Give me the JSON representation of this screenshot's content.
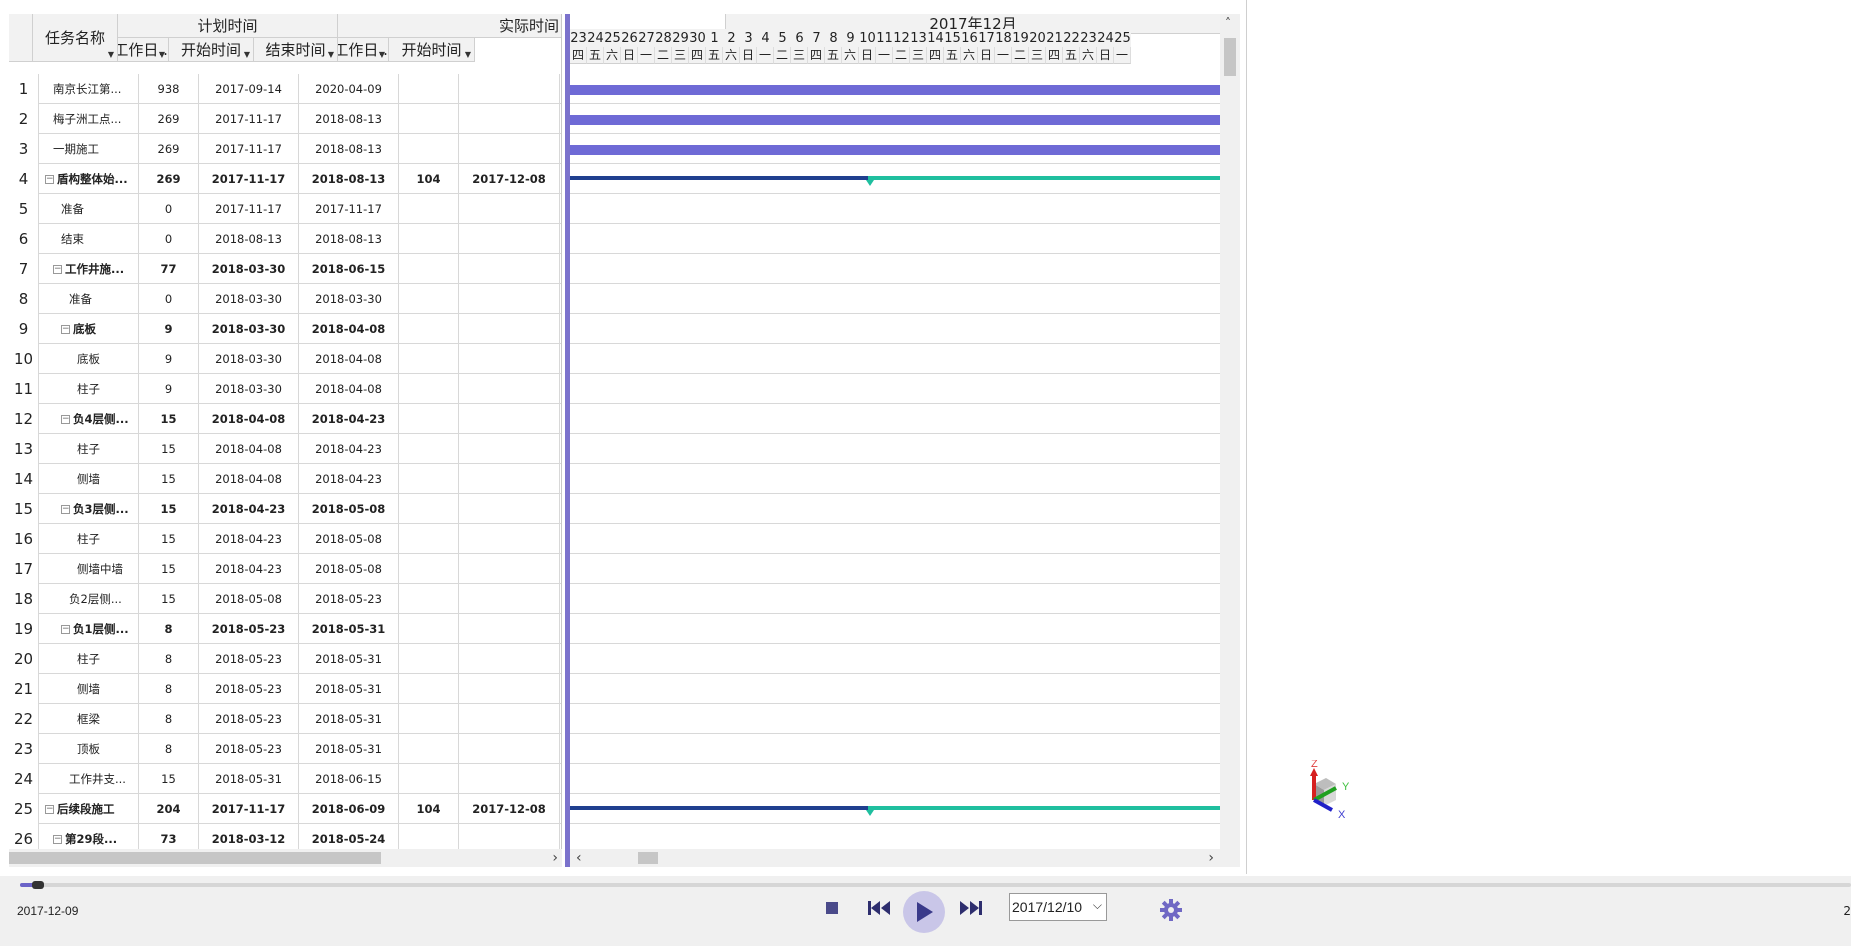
{
  "grid": {
    "headers": {
      "task_name": "任务名称",
      "plan_group": "计划时间",
      "actual_group": "实际时间",
      "plan_workdays": "工作日...",
      "plan_start": "开始时间",
      "plan_end": "结束时间",
      "actual_workdays": "工作日...",
      "actual_start": "开始时间"
    },
    "rows": [
      {
        "no": "1",
        "name": "南京长江第...",
        "workdays": "938",
        "start": "2017-09-14",
        "end": "2020-04-09",
        "a_workdays": "",
        "a_start": "",
        "summary": false,
        "indent": 0
      },
      {
        "no": "2",
        "name": "梅子洲工点...",
        "workdays": "269",
        "start": "2017-11-17",
        "end": "2018-08-13",
        "a_workdays": "",
        "a_start": "",
        "summary": false,
        "indent": 0
      },
      {
        "no": "3",
        "name": "一期施工",
        "workdays": "269",
        "start": "2017-11-17",
        "end": "2018-08-13",
        "a_workdays": "",
        "a_start": "",
        "summary": false,
        "indent": 0
      },
      {
        "no": "4",
        "name": "盾构整体始...",
        "workdays": "269",
        "start": "2017-11-17",
        "end": "2018-08-13",
        "a_workdays": "104",
        "a_start": "2017-12-08",
        "summary": true,
        "indent": 0
      },
      {
        "no": "5",
        "name": "准备",
        "workdays": "0",
        "start": "2017-11-17",
        "end": "2017-11-17",
        "a_workdays": "",
        "a_start": "",
        "summary": false,
        "indent": 1
      },
      {
        "no": "6",
        "name": "结束",
        "workdays": "0",
        "start": "2018-08-13",
        "end": "2018-08-13",
        "a_workdays": "",
        "a_start": "",
        "summary": false,
        "indent": 1
      },
      {
        "no": "7",
        "name": "工作井施...",
        "workdays": "77",
        "start": "2018-03-30",
        "end": "2018-06-15",
        "a_workdays": "",
        "a_start": "",
        "summary": true,
        "indent": 1
      },
      {
        "no": "8",
        "name": "准备",
        "workdays": "0",
        "start": "2018-03-30",
        "end": "2018-03-30",
        "a_workdays": "",
        "a_start": "",
        "summary": false,
        "indent": 2
      },
      {
        "no": "9",
        "name": "底板",
        "workdays": "9",
        "start": "2018-03-30",
        "end": "2018-04-08",
        "a_workdays": "",
        "a_start": "",
        "summary": true,
        "indent": 2
      },
      {
        "no": "10",
        "name": "底板",
        "workdays": "9",
        "start": "2018-03-30",
        "end": "2018-04-08",
        "a_workdays": "",
        "a_start": "",
        "summary": false,
        "indent": 3
      },
      {
        "no": "11",
        "name": "柱子",
        "workdays": "9",
        "start": "2018-03-30",
        "end": "2018-04-08",
        "a_workdays": "",
        "a_start": "",
        "summary": false,
        "indent": 3
      },
      {
        "no": "12",
        "name": "负4层侧...",
        "workdays": "15",
        "start": "2018-04-08",
        "end": "2018-04-23",
        "a_workdays": "",
        "a_start": "",
        "summary": true,
        "indent": 2
      },
      {
        "no": "13",
        "name": "柱子",
        "workdays": "15",
        "start": "2018-04-08",
        "end": "2018-04-23",
        "a_workdays": "",
        "a_start": "",
        "summary": false,
        "indent": 3
      },
      {
        "no": "14",
        "name": "侧墙",
        "workdays": "15",
        "start": "2018-04-08",
        "end": "2018-04-23",
        "a_workdays": "",
        "a_start": "",
        "summary": false,
        "indent": 3
      },
      {
        "no": "15",
        "name": "负3层侧...",
        "workdays": "15",
        "start": "2018-04-23",
        "end": "2018-05-08",
        "a_workdays": "",
        "a_start": "",
        "summary": true,
        "indent": 2
      },
      {
        "no": "16",
        "name": "柱子",
        "workdays": "15",
        "start": "2018-04-23",
        "end": "2018-05-08",
        "a_workdays": "",
        "a_start": "",
        "summary": false,
        "indent": 3
      },
      {
        "no": "17",
        "name": "侧墙中墙",
        "workdays": "15",
        "start": "2018-04-23",
        "end": "2018-05-08",
        "a_workdays": "",
        "a_start": "",
        "summary": false,
        "indent": 3
      },
      {
        "no": "18",
        "name": "负2层侧...",
        "workdays": "15",
        "start": "2018-05-08",
        "end": "2018-05-23",
        "a_workdays": "",
        "a_start": "",
        "summary": false,
        "indent": 2
      },
      {
        "no": "19",
        "name": "负1层侧...",
        "workdays": "8",
        "start": "2018-05-23",
        "end": "2018-05-31",
        "a_workdays": "",
        "a_start": "",
        "summary": true,
        "indent": 2
      },
      {
        "no": "20",
        "name": "柱子",
        "workdays": "8",
        "start": "2018-05-23",
        "end": "2018-05-31",
        "a_workdays": "",
        "a_start": "",
        "summary": false,
        "indent": 3
      },
      {
        "no": "21",
        "name": "侧墙",
        "workdays": "8",
        "start": "2018-05-23",
        "end": "2018-05-31",
        "a_workdays": "",
        "a_start": "",
        "summary": false,
        "indent": 3
      },
      {
        "no": "22",
        "name": "框梁",
        "workdays": "8",
        "start": "2018-05-23",
        "end": "2018-05-31",
        "a_workdays": "",
        "a_start": "",
        "summary": false,
        "indent": 3
      },
      {
        "no": "23",
        "name": "顶板",
        "workdays": "8",
        "start": "2018-05-23",
        "end": "2018-05-31",
        "a_workdays": "",
        "a_start": "",
        "summary": false,
        "indent": 3
      },
      {
        "no": "24",
        "name": "工作井支...",
        "workdays": "15",
        "start": "2018-05-31",
        "end": "2018-06-15",
        "a_workdays": "",
        "a_start": "",
        "summary": false,
        "indent": 2
      },
      {
        "no": "25",
        "name": "后续段施工",
        "workdays": "204",
        "start": "2017-11-17",
        "end": "2018-06-09",
        "a_workdays": "104",
        "a_start": "2017-12-08",
        "summary": true,
        "indent": 0
      },
      {
        "no": "26",
        "name": "第29段...",
        "workdays": "73",
        "start": "2018-03-12",
        "end": "2018-05-24",
        "a_workdays": "",
        "a_start": "",
        "summary": true,
        "indent": 1
      }
    ]
  },
  "gantt": {
    "month_label": "2017年12月",
    "days": [
      {
        "d": "23",
        "w": "四"
      },
      {
        "d": "24",
        "w": "五"
      },
      {
        "d": "25",
        "w": "六"
      },
      {
        "d": "26",
        "w": "日"
      },
      {
        "d": "27",
        "w": "一"
      },
      {
        "d": "28",
        "w": "二"
      },
      {
        "d": "29",
        "w": "三"
      },
      {
        "d": "30",
        "w": "四"
      },
      {
        "d": "1",
        "w": "五"
      },
      {
        "d": "2",
        "w": "六"
      },
      {
        "d": "3",
        "w": "日"
      },
      {
        "d": "4",
        "w": "一"
      },
      {
        "d": "5",
        "w": "二"
      },
      {
        "d": "6",
        "w": "三"
      },
      {
        "d": "7",
        "w": "四"
      },
      {
        "d": "8",
        "w": "五"
      },
      {
        "d": "9",
        "w": "六"
      },
      {
        "d": "10",
        "w": "日"
      },
      {
        "d": "11",
        "w": "一"
      },
      {
        "d": "12",
        "w": "二"
      },
      {
        "d": "13",
        "w": "三"
      },
      {
        "d": "14",
        "w": "四"
      },
      {
        "d": "15",
        "w": "五"
      },
      {
        "d": "16",
        "w": "六"
      },
      {
        "d": "17",
        "w": "日"
      },
      {
        "d": "18",
        "w": "一"
      },
      {
        "d": "19",
        "w": "二"
      },
      {
        "d": "20",
        "w": "三"
      },
      {
        "d": "21",
        "w": "四"
      },
      {
        "d": "22",
        "w": "五"
      },
      {
        "d": "23",
        "w": "六"
      },
      {
        "d": "24",
        "w": "日"
      },
      {
        "d": "25",
        "w": "一"
      }
    ],
    "colors": {
      "plan_bar": "#6f6ad6",
      "baseline": "#1f3f8f",
      "actual": "#1fbf9f",
      "splitter": "#7b72cc"
    }
  },
  "viewport": {
    "axes": {
      "z": "Z",
      "y": "Y",
      "x": "X"
    }
  },
  "timeline": {
    "current_date": "2017-12-09",
    "date_picker_value": "2017/12/10",
    "right_edge_text": "2",
    "progress_fraction": 0.008
  },
  "icons": {
    "stop": "stop-icon",
    "prev": "skip-back-icon",
    "play": "play-icon",
    "next": "skip-forward-icon",
    "settings": "gear-icon"
  }
}
